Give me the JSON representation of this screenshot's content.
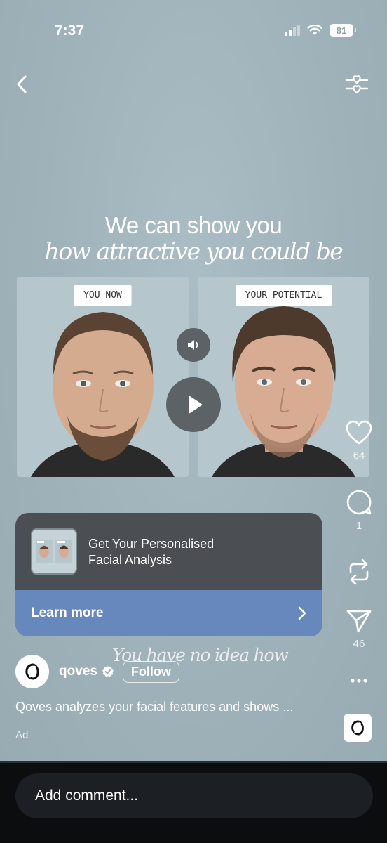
{
  "status_bar": {
    "time": "7:37",
    "battery": "81"
  },
  "headline": {
    "line1": "We can show you",
    "line2": "how attractive you could be"
  },
  "panels": {
    "left_label": "YOU NOW",
    "right_label": "YOUR POTENTIAL"
  },
  "actions": {
    "likes": "64",
    "comments": "1",
    "shares": "46"
  },
  "cta": {
    "title_line1": "Get Your Personalised",
    "title_line2": "Facial Analysis",
    "button": "Learn more"
  },
  "overlay_caption": "You have no idea how",
  "author": {
    "name": "qoves",
    "follow_label": "Follow"
  },
  "post": {
    "caption": "Qoves analyzes your facial features and shows ...",
    "ad_label": "Ad"
  },
  "comment": {
    "placeholder": "Add comment..."
  },
  "icons": [
    "back-arrow-icon",
    "filter-heart-icon",
    "sound-icon",
    "play-icon",
    "heart-icon",
    "comment-icon",
    "repost-icon",
    "send-icon",
    "more-icon",
    "chevron-right-icon",
    "verified-icon",
    "qoves-logo-icon"
  ]
}
